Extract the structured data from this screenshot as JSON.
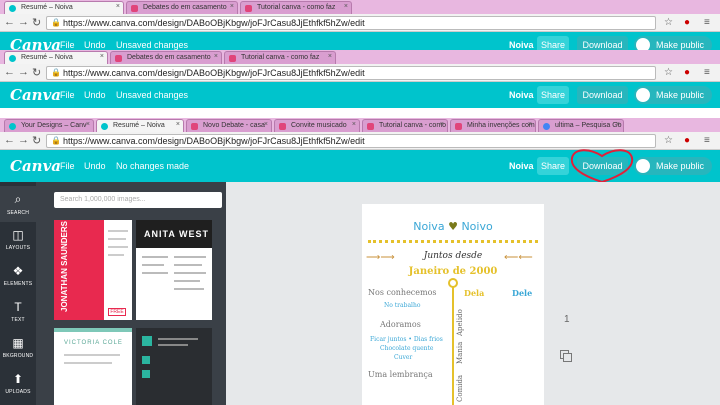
{
  "window1": {
    "tabs": [
      "Resumé – Noiva",
      "Debates do em casamento",
      "Tutorial canva - como faz"
    ],
    "url": "https://www.canva.com/design/DABoOBjKbgw/joFJrCasu8JjEthfkf5hZw/edit",
    "logo": "Canva",
    "menu": [
      "File",
      "Undo",
      "Unsaved changes"
    ],
    "design_name": "Noiva",
    "share": "Share",
    "download": "Download",
    "make_public": "Make public"
  },
  "window2": {
    "tabs": [
      "Resumé – Noiva",
      "Debates do em casamento",
      "Tutorial canva - como faz"
    ],
    "url": "https://www.canva.com/design/DABoOBjKbgw/joFJrCasu8JjEthfkf5hZw/edit",
    "logo": "Canva",
    "menu": [
      "File",
      "Undo",
      "Unsaved changes"
    ],
    "design_name": "Noiva",
    "share": "Share",
    "download": "Download",
    "make_public": "Make public"
  },
  "window3": {
    "tabs": [
      "Your Designs – Canv",
      "Resumé – Noiva",
      "Novo Debate - casa",
      "Convite musicado",
      "Tutorial canva - como",
      "Minha invenções com",
      "ultima – Pesquisa Go"
    ],
    "url": "https://www.canva.com/design/DABoOBjKbgw/joFJrCasu8JjEthfkf5hZw/edit",
    "logo": "Canva",
    "menu": [
      "File",
      "Undo",
      "No changes made"
    ],
    "design_name": "Noiva",
    "share": "Share",
    "download": "Download",
    "make_public": "Make public"
  },
  "sidebar": [
    {
      "label": "SEARCH",
      "icon": "search-icon",
      "glyph": "🔍"
    },
    {
      "label": "LAYOUTS",
      "icon": "layouts-icon",
      "glyph": "◫"
    },
    {
      "label": "ELEMENTS",
      "icon": "elements-icon",
      "glyph": "❖"
    },
    {
      "label": "TEXT",
      "icon": "text-icon",
      "glyph": "T"
    },
    {
      "label": "BKGROUND",
      "icon": "background-icon",
      "glyph": "▦"
    },
    {
      "label": "UPLOADS",
      "icon": "uploads-icon",
      "glyph": "⬆"
    }
  ],
  "panel": {
    "search_placeholder": "Search 1,000,000 images...",
    "thumb1_name": "JONATHAN SAUNDERS",
    "thumb2_name": "ANITA WEST",
    "thumb3_name": "VICTORIA COLE"
  },
  "design": {
    "title_left": "Noiva",
    "title_right": "Noivo",
    "subtitle": "Juntos desde",
    "date": "Janeiro de 2000",
    "left_lines": [
      "Nos conhecemos",
      "No trabalho",
      "Adoramos",
      "Ficar juntos • Dias frios",
      "Chocolate quente",
      "Cuver",
      "Uma lembrança"
    ],
    "col_right_1": "Dela",
    "col_right_2": "Dele",
    "vertical_labels": [
      "Apelido",
      "Mania",
      "Comida"
    ]
  },
  "colors": {
    "canva_teal": "#00c4cc",
    "tab_strip": "#e8b7e0",
    "sidebar_dark": "#2b3138",
    "panel_dark": "#3a4047",
    "design_gold": "#e5c12b",
    "design_blue": "#3aa7d6",
    "annotation_red": "#e0203a"
  }
}
